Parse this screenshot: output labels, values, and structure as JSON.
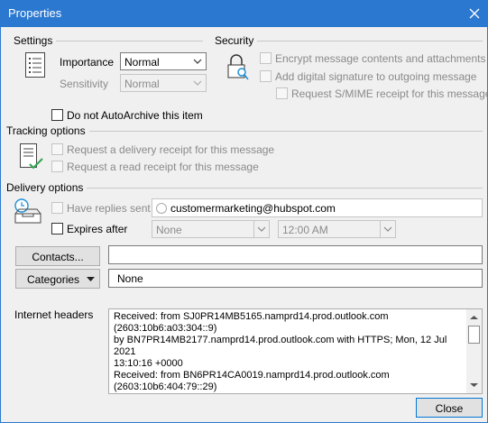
{
  "window": {
    "title": "Properties"
  },
  "settings": {
    "section_label": "Settings",
    "importance_label": "Importance",
    "importance_value": "Normal",
    "sensitivity_label": "Sensitivity",
    "sensitivity_value": "Normal"
  },
  "security": {
    "section_label": "Security",
    "encrypt_label": "Encrypt message contents and attachments",
    "signature_label": "Add digital signature to outgoing message",
    "smime_label": "Request S/MIME receipt for this message"
  },
  "autoarchive": {
    "label": "Do not AutoArchive this item"
  },
  "tracking": {
    "section_label": "Tracking options",
    "delivery_receipt_label": "Request a delivery receipt for this message",
    "read_receipt_label": "Request a read receipt for this message"
  },
  "delivery": {
    "section_label": "Delivery options",
    "replies_label": "Have replies sent to",
    "replies_value": "customermarketing@hubspot.com",
    "expires_label": "Expires after",
    "expires_date": "None",
    "expires_time": "12:00 AM"
  },
  "contacts": {
    "button_label": "Contacts..."
  },
  "categories": {
    "button_label": "Categories",
    "value": "None"
  },
  "internet_headers": {
    "label": "Internet headers",
    "lines": [
      "Received: from SJ0PR14MB5165.namprd14.prod.outlook.com",
      "(2603:10b6:a03:304::9)",
      " by BN7PR14MB2177.namprd14.prod.outlook.com with HTTPS; Mon, 12 Jul",
      "2021",
      " 13:10:16 +0000",
      "Received: from BN6PR14CA0019.namprd14.prod.outlook.com",
      "(2603:10b6:404:79::29)"
    ]
  },
  "footer": {
    "close_label": "Close"
  }
}
